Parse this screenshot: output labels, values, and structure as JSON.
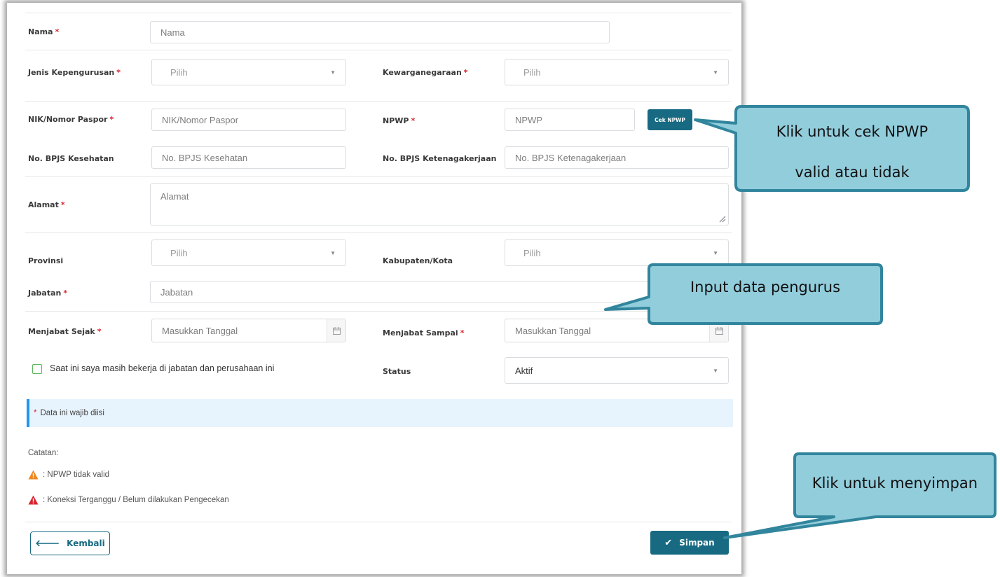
{
  "form": {
    "nama": {
      "label": "Nama",
      "placeholder": "Nama"
    },
    "jenis_kepengurusan": {
      "label": "Jenis Kepengurusan",
      "value": "Pilih"
    },
    "kewarganegaraan": {
      "label": "Kewarganegaraan",
      "value": "Pilih"
    },
    "nik": {
      "label": "NIK/Nomor Paspor",
      "placeholder": "NIK/Nomor Paspor"
    },
    "npwp": {
      "label": "NPWP",
      "placeholder": "NPWP",
      "button": "Cek NPWP"
    },
    "bpjs_kesehatan": {
      "label": "No. BPJS Kesehatan",
      "placeholder": "No. BPJS Kesehatan"
    },
    "bpjs_ketenagakerjaan": {
      "label": "No. BPJS Ketenagakerjaan",
      "placeholder": "No. BPJS Ketenagakerjaan"
    },
    "alamat": {
      "label": "Alamat",
      "placeholder": "Alamat"
    },
    "provinsi": {
      "label": "Provinsi",
      "value": "Pilih"
    },
    "kabupaten": {
      "label": "Kabupaten/Kota",
      "value": "Pilih"
    },
    "jabatan": {
      "label": "Jabatan",
      "placeholder": "Jabatan"
    },
    "menjabat_sejak": {
      "label": "Menjabat Sejak",
      "placeholder": "Masukkan Tanggal"
    },
    "menjabat_sampai": {
      "label": "Menjabat Sampai",
      "placeholder": "Masukkan Tanggal"
    },
    "masih_bekerja": {
      "label": "Saat ini saya masih bekerja di jabatan dan perusahaan ini"
    },
    "status": {
      "label": "Status",
      "value": "Aktif"
    },
    "required_marker": "*"
  },
  "info": {
    "text": "Data ini wajib diisi"
  },
  "notes": {
    "title": "Catatan:",
    "items": [
      {
        "icon": "warning-orange-icon",
        "color": "#f0861d",
        "text": ": NPWP tidak valid"
      },
      {
        "icon": "warning-red-icon",
        "color": "#d9242f",
        "text": ": Koneksi Terganggu / Belum dilakukan Pengecekan"
      }
    ]
  },
  "actions": {
    "back": "Kembali",
    "save": "Simpan"
  },
  "callouts": {
    "npwp_line1": "Klik untuk cek NPWP",
    "npwp_line2": "valid atau tidak",
    "input": "Input data pengurus",
    "save": "Klik untuk menyimpan"
  },
  "colors": {
    "primary": "#176a81",
    "required": "#d9242f",
    "callout_fill": "#92cddc",
    "callout_border": "#31859c"
  }
}
